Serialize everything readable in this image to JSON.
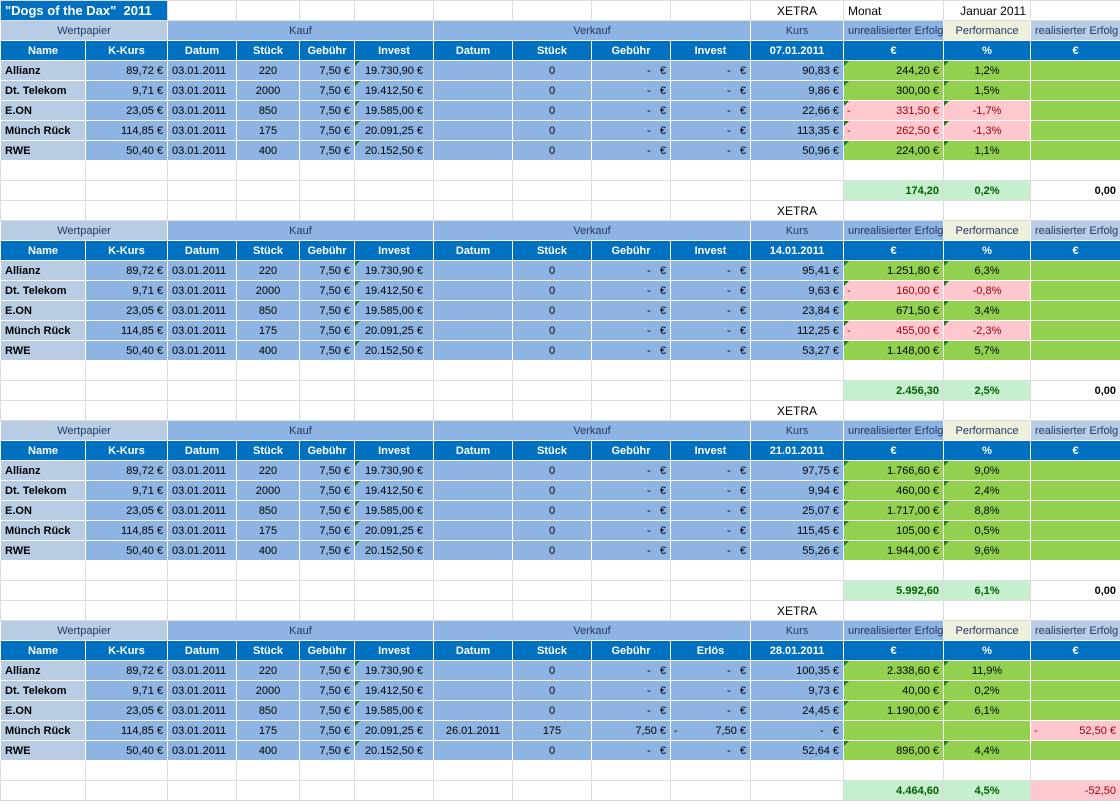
{
  "title": "\"Dogs of the Dax\"  2011",
  "exchange": "XETRA",
  "month_label": "Monat",
  "month_value": "Januar 2011",
  "group_headers": {
    "wertpapier": "Wertpapier",
    "kauf": "Kauf",
    "verkauf": "Verkauf",
    "kurs": "Kurs",
    "unreal": "unrealisierter Erfolg",
    "performance": "Performance",
    "real": "realisierter Erfolg"
  },
  "col_headers": [
    "Name",
    "K-Kurs",
    "Datum",
    "Stück",
    "Gebühr",
    "Invest",
    "Datum",
    "Stück",
    "Gebühr"
  ],
  "unit_headers": [
    "€",
    "%",
    "€"
  ],
  "colors": {
    "header_blue": "#0070c0",
    "light_blue": "#8db4e2",
    "pale_blue": "#b8cce4",
    "positive": "#92d050",
    "negative": "#ffc7ce",
    "total_green": "#c6efce"
  },
  "blocks": [
    {
      "date": "07.01.2011",
      "verkauf_last": "Invest",
      "rows": [
        [
          "Allianz",
          "89,72 €",
          "03.01.2011",
          "220",
          "7,50 €",
          "19.730,90 €",
          "",
          "0",
          "-   €",
          "-   €",
          "90,83 €",
          "244,20 €",
          "1,2%",
          ""
        ],
        [
          "Dt. Telekom",
          "9,71 €",
          "03.01.2011",
          "2000",
          "7,50 €",
          "19.412,50 €",
          "",
          "0",
          "-   €",
          "-   €",
          "9,86 €",
          "300,00 €",
          "1,5%",
          ""
        ],
        [
          "E.ON",
          "23,05 €",
          "03.01.2011",
          "850",
          "7,50 €",
          "19.585,00 €",
          "",
          "0",
          "-   €",
          "-   €",
          "22,66 €",
          "-331,50 €",
          "-1,7%",
          ""
        ],
        [
          "Münch Rück",
          "114,85 €",
          "03.01.2011",
          "175",
          "7,50 €",
          "20.091,25 €",
          "",
          "0",
          "-   €",
          "-   €",
          "113,35 €",
          "-262,50 €",
          "-1,3%",
          ""
        ],
        [
          "RWE",
          "50,40 €",
          "03.01.2011",
          "400",
          "7,50 €",
          "20.152,50 €",
          "",
          "0",
          "-   €",
          "-   €",
          "50,96 €",
          "224,00 €",
          "1,1%",
          ""
        ]
      ],
      "total": {
        "unreal": "174,20",
        "perf": "0,2%",
        "real": "0,00"
      }
    },
    {
      "date": "14.01.2011",
      "verkauf_last": "Invest",
      "rows": [
        [
          "Allianz",
          "89,72 €",
          "03.01.2011",
          "220",
          "7,50 €",
          "19.730,90 €",
          "",
          "0",
          "-   €",
          "-   €",
          "95,41 €",
          "1.251,80 €",
          "6,3%",
          ""
        ],
        [
          "Dt. Telekom",
          "9,71 €",
          "03.01.2011",
          "2000",
          "7,50 €",
          "19.412,50 €",
          "",
          "0",
          "-   €",
          "-   €",
          "9,63 €",
          "-160,00 €",
          "-0,8%",
          ""
        ],
        [
          "E.ON",
          "23,05 €",
          "03.01.2011",
          "850",
          "7,50 €",
          "19.585,00 €",
          "",
          "0",
          "-   €",
          "-   €",
          "23,84 €",
          "671,50 €",
          "3,4%",
          ""
        ],
        [
          "Münch Rück",
          "114,85 €",
          "03.01.2011",
          "175",
          "7,50 €",
          "20.091,25 €",
          "",
          "0",
          "-   €",
          "-   €",
          "112,25 €",
          "-455,00 €",
          "-2,3%",
          ""
        ],
        [
          "RWE",
          "50,40 €",
          "03.01.2011",
          "400",
          "7,50 €",
          "20.152,50 €",
          "",
          "0",
          "-   €",
          "-   €",
          "53,27 €",
          "1.148,00 €",
          "5,7%",
          ""
        ]
      ],
      "total": {
        "unreal": "2.456,30",
        "perf": "2,5%",
        "real": "0,00"
      }
    },
    {
      "date": "21.01.2011",
      "verkauf_last": "Invest",
      "rows": [
        [
          "Allianz",
          "89,72 €",
          "03.01.2011",
          "220",
          "7,50 €",
          "19.730,90 €",
          "",
          "0",
          "-   €",
          "-   €",
          "97,75 €",
          "1.766,60 €",
          "9,0%",
          ""
        ],
        [
          "Dt. Telekom",
          "9,71 €",
          "03.01.2011",
          "2000",
          "7,50 €",
          "19.412,50 €",
          "",
          "0",
          "-   €",
          "-   €",
          "9,94 €",
          "460,00 €",
          "2,4%",
          ""
        ],
        [
          "E.ON",
          "23,05 €",
          "03.01.2011",
          "850",
          "7,50 €",
          "19.585,00 €",
          "",
          "0",
          "-   €",
          "-   €",
          "25,07 €",
          "1.717,00 €",
          "8,8%",
          ""
        ],
        [
          "Münch Rück",
          "114,85 €",
          "03.01.2011",
          "175",
          "7,50 €",
          "20.091,25 €",
          "",
          "0",
          "-   €",
          "-   €",
          "115,45 €",
          "105,00 €",
          "0,5%",
          ""
        ],
        [
          "RWE",
          "50,40 €",
          "03.01.2011",
          "400",
          "7,50 €",
          "20.152,50 €",
          "",
          "0",
          "-   €",
          "-   €",
          "55,26 €",
          "1.944,00 €",
          "9,6%",
          ""
        ]
      ],
      "total": {
        "unreal": "5.992,60",
        "perf": "6,1%",
        "real": "0,00"
      }
    },
    {
      "date": "28.01.2011",
      "verkauf_last": "Erlös",
      "rows": [
        [
          "Allianz",
          "89,72 €",
          "03.01.2011",
          "220",
          "7,50 €",
          "19.730,90 €",
          "",
          "0",
          "-   €",
          "-   €",
          "100,35 €",
          "2.338,60 €",
          "11,9%",
          ""
        ],
        [
          "Dt. Telekom",
          "9,71 €",
          "03.01.2011",
          "2000",
          "7,50 €",
          "19.412,50 €",
          "",
          "0",
          "-   €",
          "-   €",
          "9,73 €",
          "40,00 €",
          "0,2%",
          ""
        ],
        [
          "E.ON",
          "23,05 €",
          "03.01.2011",
          "850",
          "7,50 €",
          "19.585,00 €",
          "",
          "0",
          "-   €",
          "-   €",
          "24,45 €",
          "1.190,00 €",
          "6,1%",
          ""
        ],
        [
          "Münch Rück",
          "114,85 €",
          "03.01.2011",
          "175",
          "7,50 €",
          "20.091,25 €",
          "26.01.2011",
          "175",
          "7,50 €",
          "-7,50 €",
          "-   €",
          "",
          "",
          "-52,50 €"
        ],
        [
          "RWE",
          "50,40 €",
          "03.01.2011",
          "400",
          "7,50 €",
          "20.152,50 €",
          "",
          "0",
          "-   €",
          "-   €",
          "52,64 €",
          "896,00 €",
          "4,4%",
          ""
        ]
      ],
      "total": {
        "unreal": "4.464,60",
        "perf": "4,5%",
        "real": "-52,50"
      }
    }
  ]
}
